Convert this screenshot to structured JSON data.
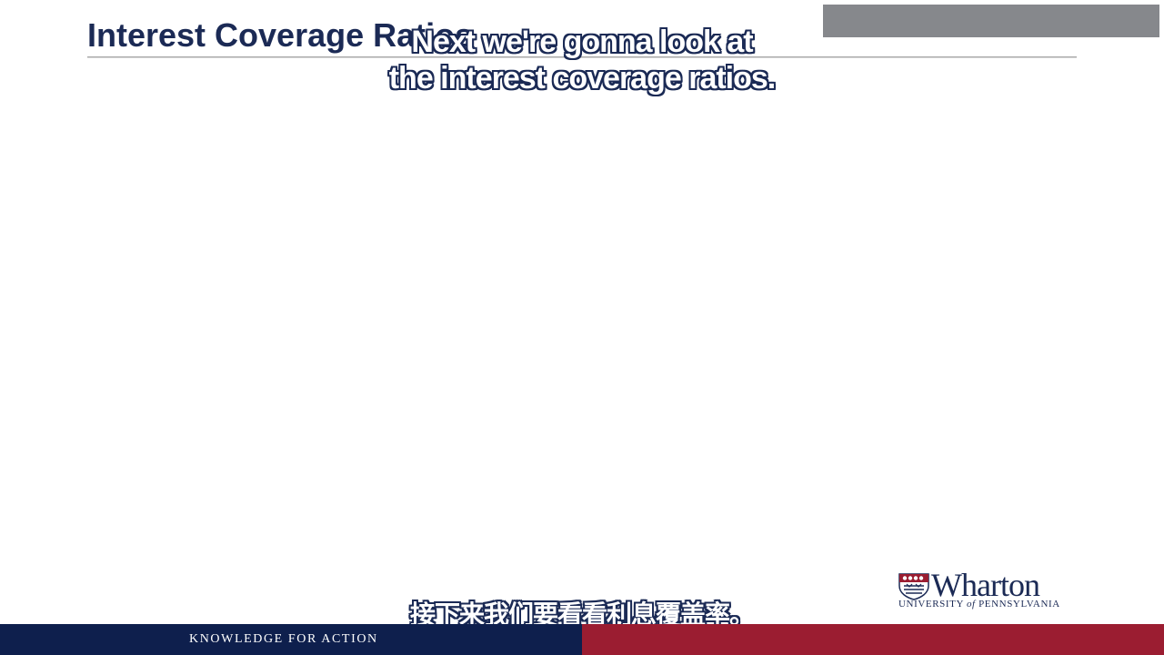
{
  "slide": {
    "title": "Interest Coverage Ratios"
  },
  "subtitles": {
    "english": "Next we're gonna look at\nthe interest coverage ratios.",
    "english_line1": "Next we're gonna look at",
    "english_line2": "the interest coverage ratios.",
    "chinese": "接下来我们要看看利息覆盖率。"
  },
  "logo": {
    "wordmark": "Wharton",
    "university": "UNIVERSITY",
    "of": "of",
    "pennsylvania": "PENNSYLVANIA"
  },
  "footer": {
    "tagline": "KNOWLEDGE FOR ACTION"
  },
  "colors": {
    "title": "#1b2a55",
    "footer_navy": "#0e1f4d",
    "footer_red": "#9b1d31",
    "header_gray": "#86888c"
  }
}
